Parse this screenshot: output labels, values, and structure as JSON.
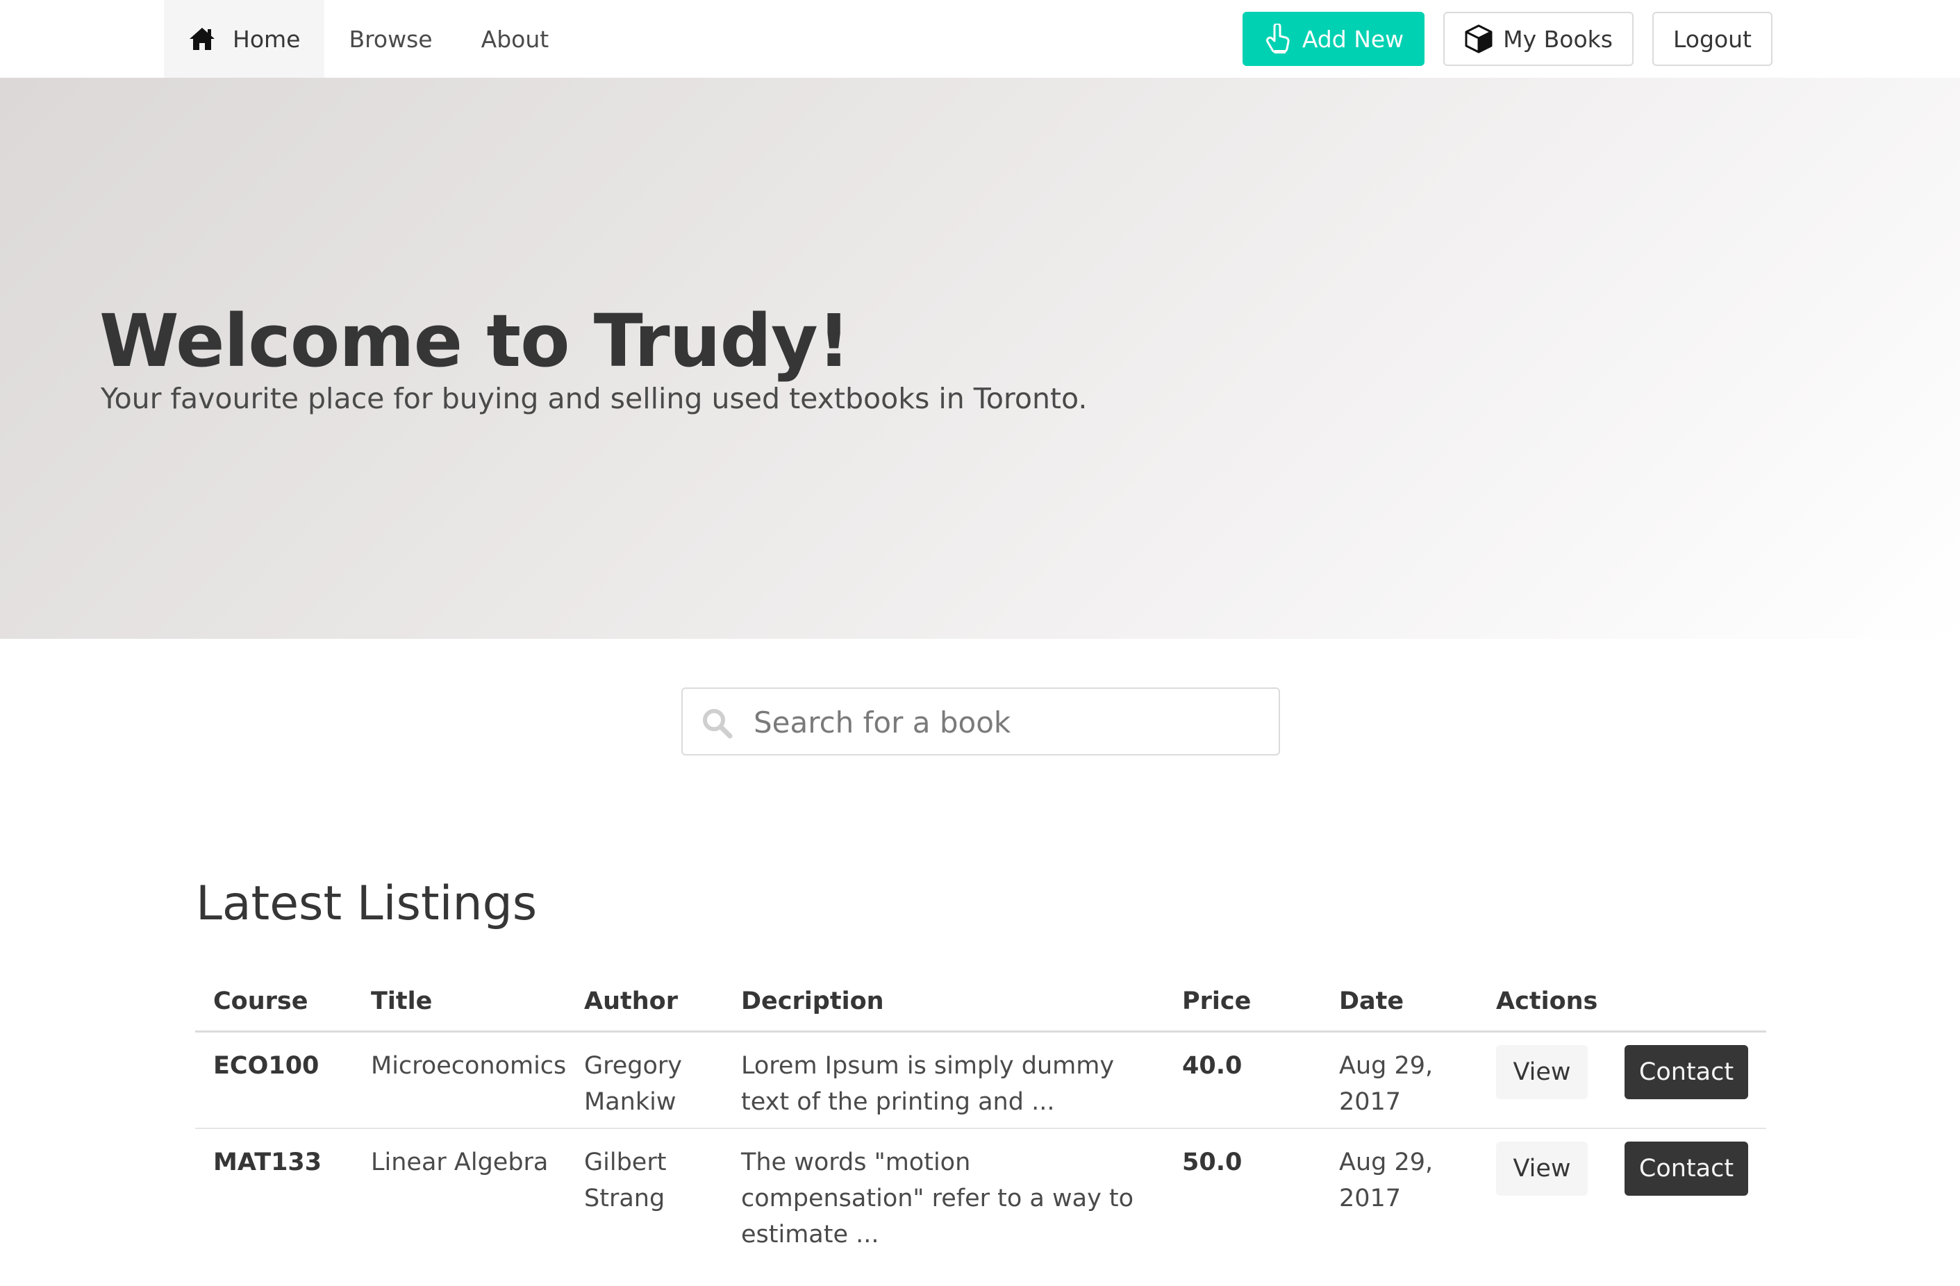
{
  "nav": {
    "items": [
      {
        "label": "Home",
        "icon": "home-icon",
        "active": true
      },
      {
        "label": "Browse"
      },
      {
        "label": "About"
      }
    ],
    "buttons": {
      "add_new": "Add New",
      "my_books": "My Books",
      "logout": "Logout"
    }
  },
  "hero": {
    "title": "Welcome to Trudy!",
    "subtitle": "Your favourite place for buying and selling used textbooks in Toronto."
  },
  "search": {
    "placeholder": "Search for a book",
    "value": ""
  },
  "listings": {
    "title": "Latest Listings",
    "columns": [
      "Course",
      "Title",
      "Author",
      "Decription",
      "Price",
      "Date",
      "Actions"
    ],
    "rows": [
      {
        "course": "ECO100",
        "title": "Microeconomics",
        "author": "Gregory Mankiw",
        "description": "Lorem Ipsum is simply dummy text of the printing and ...",
        "price": "40.0",
        "date": "Aug 29, 2017",
        "view_label": "View",
        "contact_label": "Contact"
      },
      {
        "course": "MAT133",
        "title": "Linear Algebra",
        "author": "Gilbert Strang",
        "description": "The words \"motion compensation\" refer to a way to estimate ...",
        "price": "50.0",
        "date": "Aug 29, 2017",
        "view_label": "View",
        "contact_label": "Contact"
      }
    ]
  },
  "colors": {
    "accent": "#00d1b2",
    "dark": "#363636",
    "light": "#f5f5f5",
    "border": "#dbdbdb"
  }
}
